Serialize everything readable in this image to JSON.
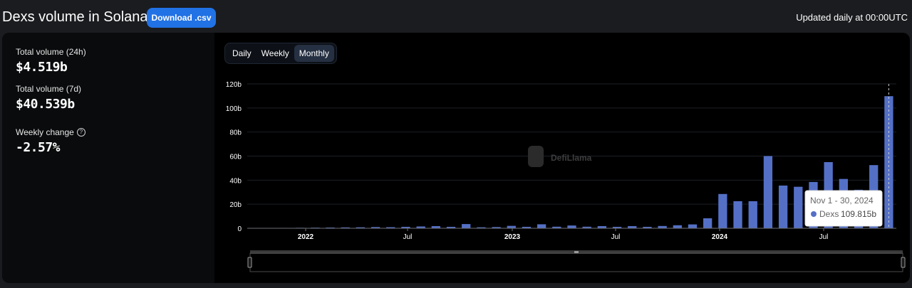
{
  "header": {
    "title": "Dexs volume in Solana",
    "download_label": "Download .csv",
    "updated": "Updated daily at 00:00UTC"
  },
  "stats": [
    {
      "label": "Total volume (24h)",
      "value": "$4.519b"
    },
    {
      "label": "Total volume (7d)",
      "value": "$40.539b"
    },
    {
      "label": "Weekly change",
      "value": "-2.57%",
      "icon": "help-icon"
    }
  ],
  "toggle": {
    "options": [
      "Daily",
      "Weekly",
      "Monthly"
    ],
    "active": "Monthly"
  },
  "watermark": "DefiLlama",
  "tooltip": {
    "date": "Nov 1 - 30, 2024",
    "series": "Dexs",
    "value": "109.815b"
  },
  "chart_data": {
    "type": "bar",
    "series_name": "Dexs",
    "bar_color": "#5470c6",
    "unit": "b",
    "ylim": [
      0,
      120
    ],
    "y_ticks": [
      "0",
      "20b",
      "40b",
      "60b",
      "80b",
      "100b",
      "120b"
    ],
    "x_tick_labels": [
      "2022",
      "Jul",
      "2023",
      "Jul",
      "2024",
      "Jul"
    ],
    "categories": [
      "2021-09",
      "2021-10",
      "2021-11",
      "2021-12",
      "2022-01",
      "2022-02",
      "2022-03",
      "2022-04",
      "2022-05",
      "2022-06",
      "2022-07",
      "2022-08",
      "2022-09",
      "2022-10",
      "2022-11",
      "2022-12",
      "2023-01",
      "2023-02",
      "2023-03",
      "2023-04",
      "2023-05",
      "2023-06",
      "2023-07",
      "2023-08",
      "2023-09",
      "2023-10",
      "2023-11",
      "2023-12",
      "2024-01",
      "2024-02",
      "2024-03",
      "2024-04",
      "2024-05",
      "2024-06",
      "2024-07",
      "2024-08",
      "2024-09",
      "2024-10",
      "2024-11"
    ],
    "values": [
      0.1,
      0.2,
      0.3,
      0.4,
      0.5,
      0.6,
      0.7,
      0.8,
      1.0,
      0.9,
      1.2,
      1.5,
      1.8,
      1.2,
      3.5,
      0.8,
      1.0,
      2.0,
      1.2,
      3.3,
      1.3,
      2.3,
      1.3,
      1.8,
      1.2,
      1.8,
      1.2,
      1.9,
      2.5,
      3.2,
      8.3,
      28.5,
      22.5,
      22.5,
      60,
      35.5,
      34.5,
      38.5,
      55,
      41,
      32,
      52.5,
      109.815
    ],
    "highlight_index": 42
  }
}
